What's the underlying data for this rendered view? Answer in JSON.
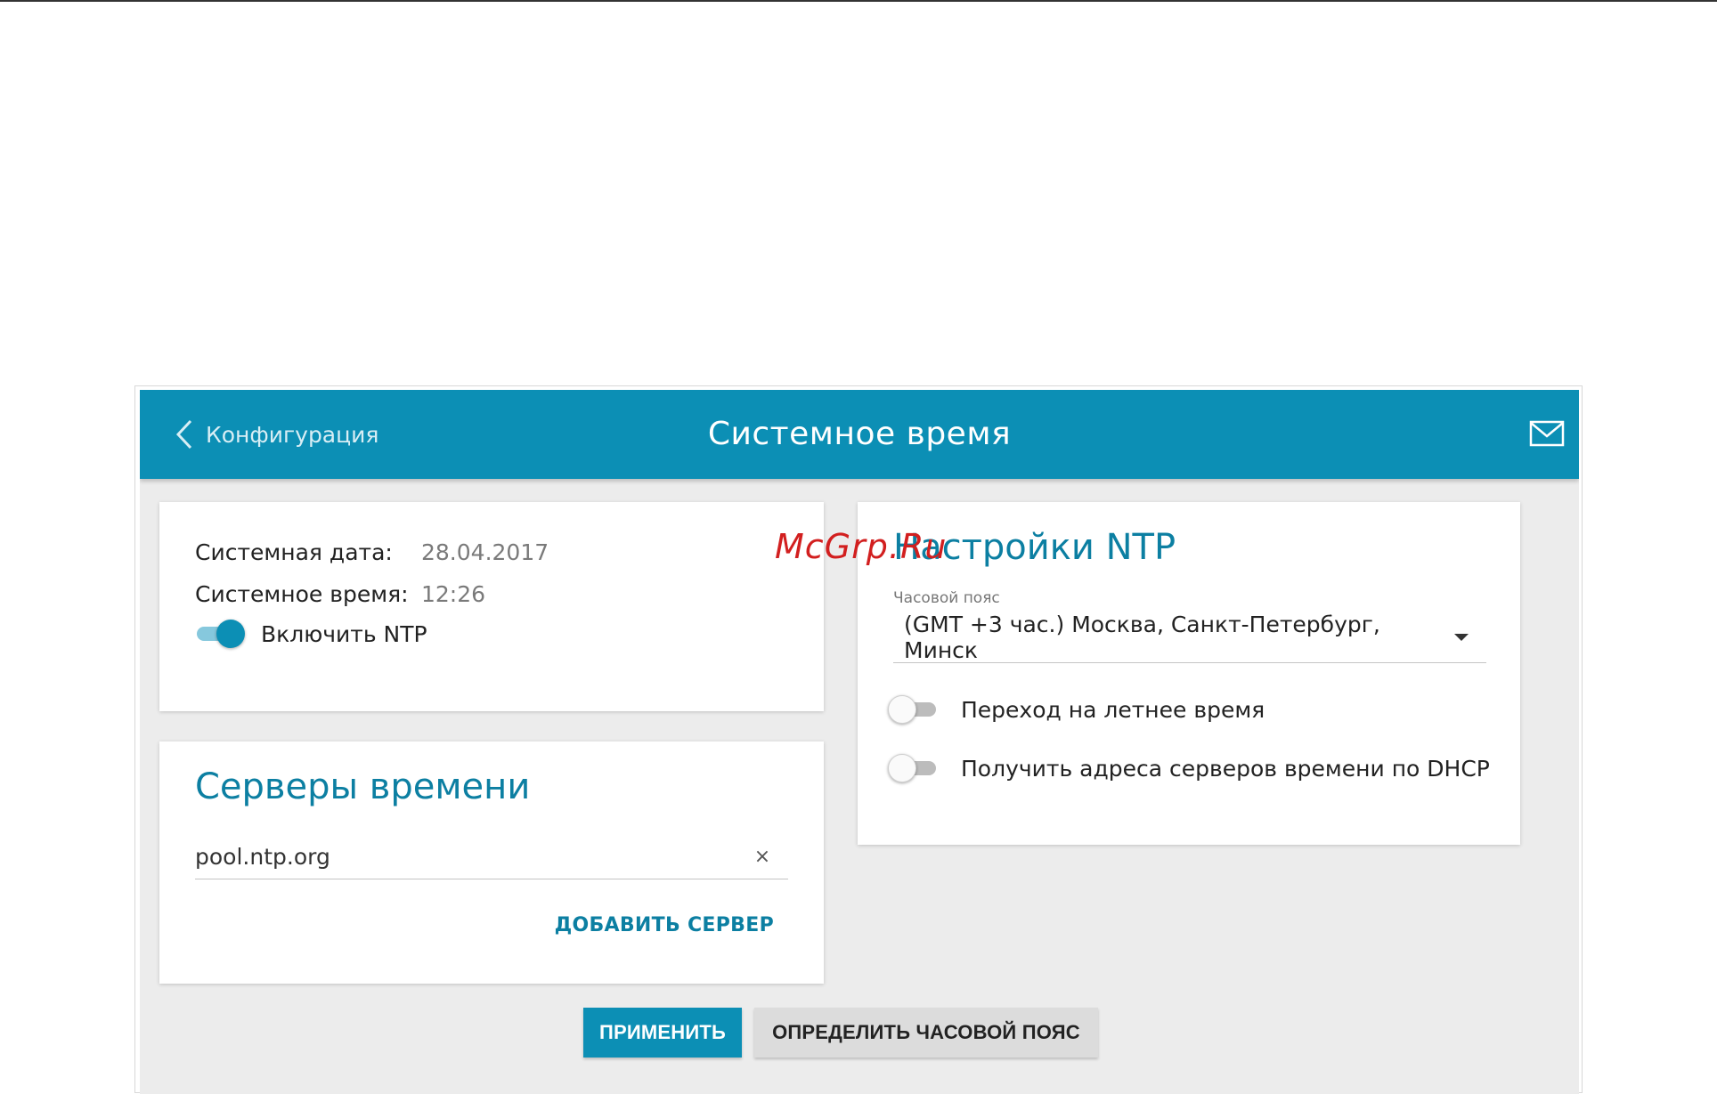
{
  "header": {
    "back_label": "Конфигурация",
    "title": "Системное время"
  },
  "info": {
    "date_label": "Системная дата:",
    "date_value": "28.04.2017",
    "time_label": "Системное время:",
    "time_value": "12:26",
    "ntp_toggle_label": "Включить NTP",
    "ntp_enabled": true
  },
  "servers": {
    "title": "Серверы времени",
    "items": [
      "pool.ntp.org"
    ],
    "add_label": "ДОБАВИТЬ СЕРВЕР"
  },
  "ntp": {
    "title": "Настройки NTP",
    "timezone_label": "Часовой пояс",
    "timezone_value": "(GMT +3 час.) Москва, Санкт-Петербург, Минск",
    "dst_label": "Переход на летнее время",
    "dst_enabled": false,
    "dhcp_label": "Получить адреса серверов времени по DHCP",
    "dhcp_enabled": false
  },
  "actions": {
    "apply_label": "ПРИМЕНИТЬ",
    "detect_label": "ОПРЕДЕЛИТЬ ЧАСОВОЙ ПОЯС"
  },
  "watermark": "McGrp.Ru",
  "colors": {
    "accent": "#0c8fb5",
    "title_text": "#0c7fa2",
    "background": "#ececec",
    "watermark": "#d21f1f"
  }
}
